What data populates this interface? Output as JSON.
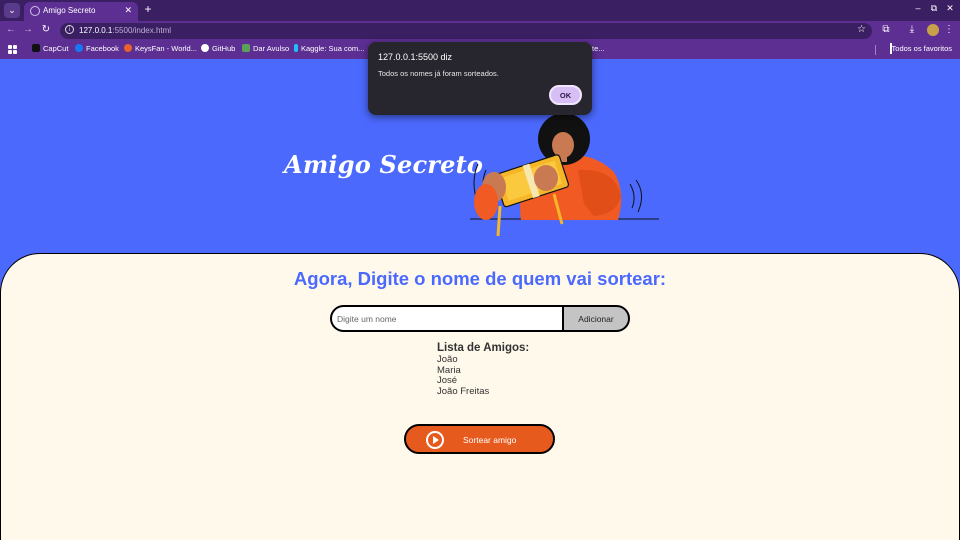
{
  "browser": {
    "tab_title": "Amigo Secreto",
    "tab_close": "✕",
    "new_tab": "+",
    "url_host": "127.0.0.1",
    "url_rest": ":5500/index.html",
    "window_controls": {
      "minimize": "–",
      "restore": "⧉",
      "close": "✕"
    }
  },
  "bookmarks": {
    "items": [
      {
        "label": "CapCut",
        "icon": "capcut-icon",
        "color": "#111111"
      },
      {
        "label": "Facebook",
        "icon": "facebook-icon",
        "color": "#1877f2"
      },
      {
        "label": "KeysFan - World...",
        "icon": "keysfan-icon",
        "color": "#e8622a"
      },
      {
        "label": "GitHub",
        "icon": "github-icon",
        "color": "#ffffff"
      },
      {
        "label": "Dar Avulso",
        "icon": "dar-avulso-icon",
        "color": "#5aa05a"
      },
      {
        "label": "Kaggle: Sua com...",
        "icon": "kaggle-icon",
        "color": "#20beff"
      }
    ],
    "truncated_item": "te...",
    "all_bookmarks": "Todos os favoritos"
  },
  "page": {
    "title": "Amigo Secreto",
    "heading": "Agora, Digite o nome de quem vai sortear:",
    "input_placeholder": "Digite um nome",
    "add_button": "Adicionar",
    "list_title": "Lista de Amigos:",
    "friends": [
      "João",
      "Maria",
      "José",
      "João Freitas"
    ],
    "draw_button": "Sortear amigo"
  },
  "dialog": {
    "origin": "127.0.0.1:5500 diz",
    "message": "Todos os nomes já foram sorteados.",
    "ok_button": "OK"
  },
  "colors": {
    "hero_bg": "#4b69fd",
    "panel_bg": "#fff9eb",
    "accent_orange": "#e75a1e",
    "browser_purple": "#5d2f93"
  }
}
